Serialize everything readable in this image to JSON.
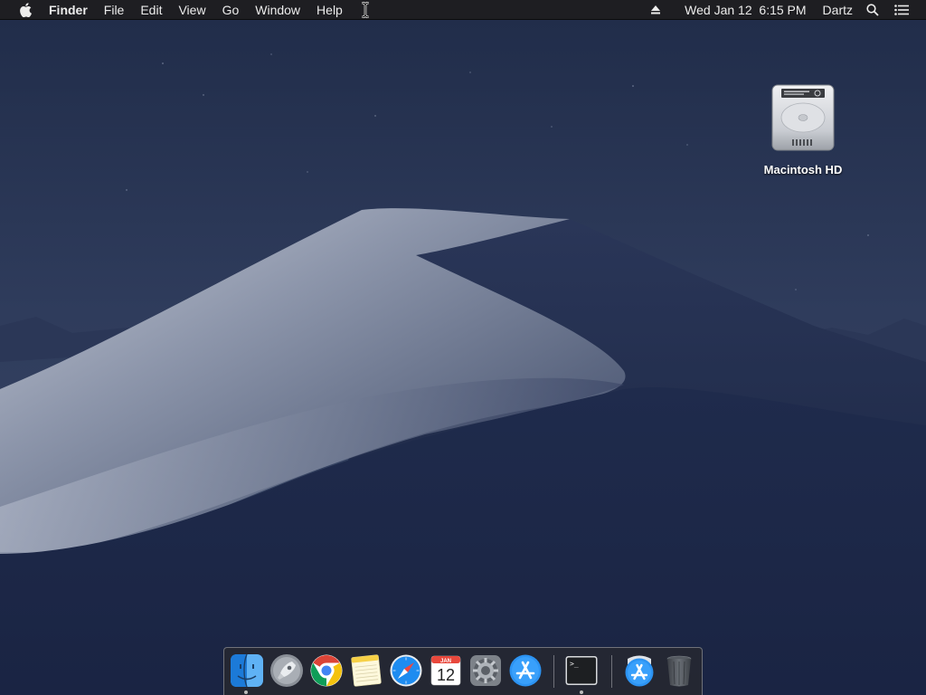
{
  "menubar": {
    "apple_icon": "apple-icon",
    "app_name": "Finder",
    "menus": [
      "File",
      "Edit",
      "View",
      "Go",
      "Window",
      "Help"
    ],
    "status": {
      "eject_icon": "eject-icon",
      "datetime": "Wed Jan 12  6:15 PM",
      "user": "Dartz",
      "spotlight_icon": "search-icon",
      "notification_icon": "notification-center-icon"
    }
  },
  "desktop": {
    "icons": [
      {
        "label": "Macintosh HD",
        "icon": "hard-drive-icon"
      }
    ]
  },
  "dock": {
    "apps": [
      {
        "name": "Finder",
        "icon": "finder-icon",
        "running": true
      },
      {
        "name": "Launchpad",
        "icon": "launchpad-icon",
        "running": false
      },
      {
        "name": "Google Chrome",
        "icon": "chrome-icon",
        "running": false
      },
      {
        "name": "Notes",
        "icon": "notes-icon",
        "running": false
      },
      {
        "name": "Safari",
        "icon": "safari-icon",
        "running": false
      },
      {
        "name": "Calendar",
        "icon": "calendar-icon",
        "running": false,
        "month": "JAN",
        "day": "12"
      },
      {
        "name": "System Preferences",
        "icon": "system-preferences-icon",
        "running": false
      },
      {
        "name": "App Store",
        "icon": "app-store-icon",
        "running": false
      },
      {
        "name": "Terminal",
        "icon": "terminal-icon",
        "running": true,
        "prompt": ">_"
      },
      {
        "name": "Applications",
        "icon": "applications-folder-icon",
        "running": false
      },
      {
        "name": "Trash",
        "icon": "trash-icon",
        "running": false
      }
    ]
  },
  "colors": {
    "menubar_bg": "#1e1e20",
    "sky_top": "#24314f",
    "sky_bottom": "#3c4a68",
    "dune_light": "#9aa3b6",
    "dune_dark": "#1a2546"
  }
}
